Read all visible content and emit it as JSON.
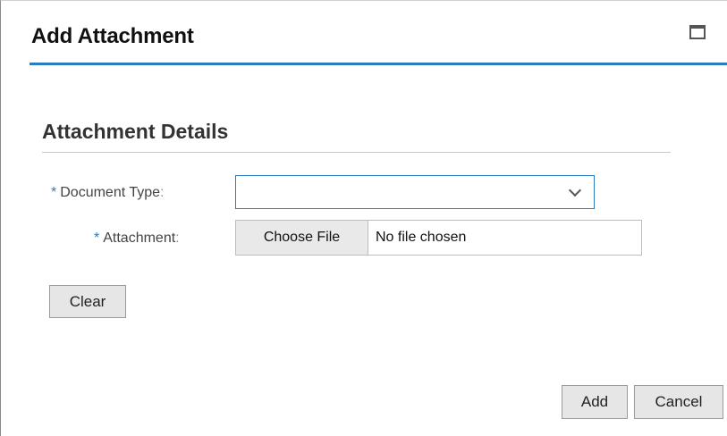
{
  "dialog": {
    "title": "Add Attachment",
    "maximize_icon": "maximize-icon"
  },
  "section": {
    "title": "Attachment Details"
  },
  "form": {
    "required_marker": "*",
    "document_type": {
      "label": "Document Type",
      "colon": ":",
      "value": "",
      "icon": "chevron-down-icon"
    },
    "attachment": {
      "label": "Attachment",
      "colon": ":",
      "button_label": "Choose File",
      "status": "No file chosen"
    }
  },
  "buttons": {
    "clear": "Clear",
    "add": "Add",
    "cancel": "Cancel"
  },
  "colors": {
    "accent": "#2b7bbf",
    "button_bg": "#e6e6e6"
  }
}
